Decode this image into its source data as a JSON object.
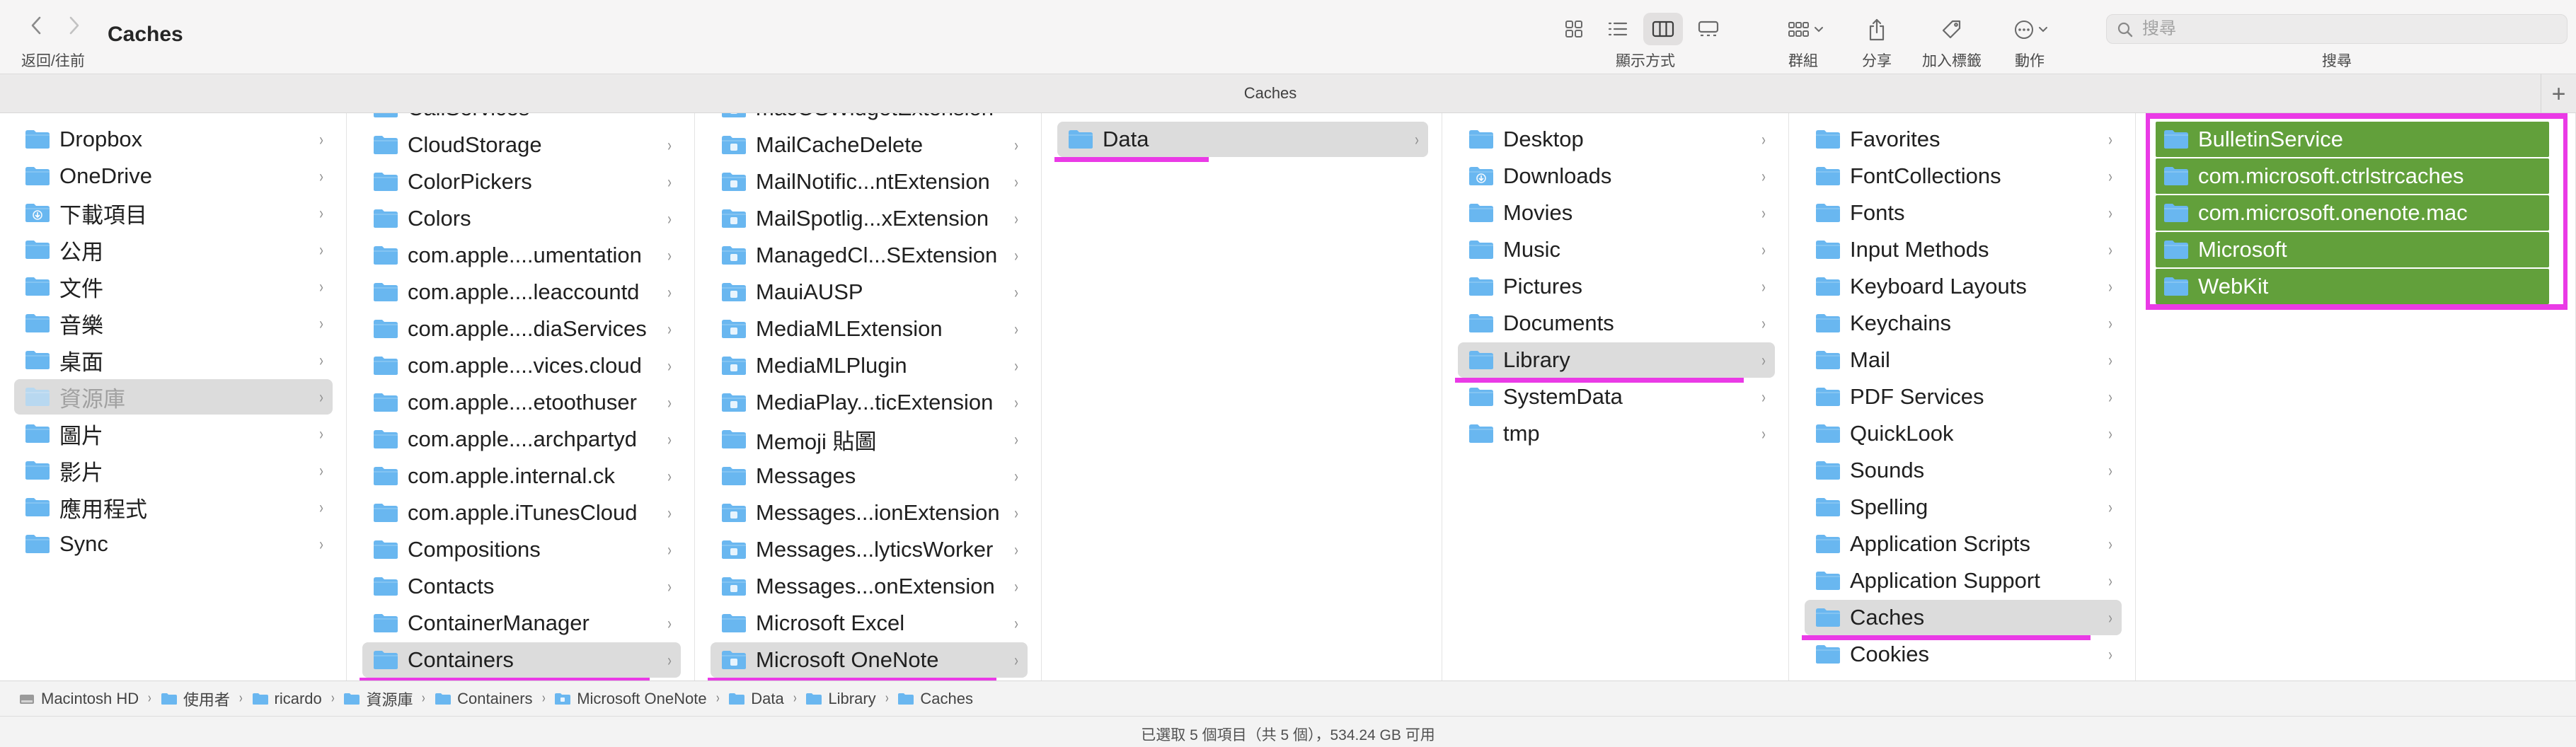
{
  "toolbar": {
    "title": "Caches",
    "nav_label": "返回/往前",
    "view_mode_label": "顯示方式",
    "group_label": "群組",
    "share_label": "分享",
    "tags_label": "加入標籤",
    "action_label": "動作",
    "search_label": "搜尋",
    "search_placeholder": "搜尋"
  },
  "tab": {
    "title": "Caches",
    "add_symbol": "+"
  },
  "colors": {
    "selection_mark": "#ea3ae6",
    "selected_green": "#62a03b",
    "folder_blue": "#6ab7f0"
  },
  "columns": [
    {
      "items": [
        {
          "label": "Dropbox",
          "icon": "folder-icon",
          "chevron": true
        },
        {
          "label": "OneDrive",
          "icon": "folder-icon",
          "chevron": true
        },
        {
          "label": "下載項目",
          "icon": "downloads-folder-icon",
          "chevron": true
        },
        {
          "label": "公用",
          "icon": "folder-icon",
          "chevron": true
        },
        {
          "label": "文件",
          "icon": "folder-icon",
          "chevron": true
        },
        {
          "label": "音樂",
          "icon": "folder-icon",
          "chevron": true
        },
        {
          "label": "桌面",
          "icon": "folder-icon",
          "chevron": true
        },
        {
          "label": "資源庫",
          "icon": "folder-icon",
          "chevron": true,
          "state": "selected-dim"
        },
        {
          "label": "圖片",
          "icon": "folder-icon",
          "chevron": true
        },
        {
          "label": "影片",
          "icon": "folder-icon",
          "chevron": true
        },
        {
          "label": "應用程式",
          "icon": "folder-icon",
          "chevron": true
        },
        {
          "label": "Sync",
          "icon": "folder-icon",
          "chevron": true
        }
      ]
    },
    {
      "items": [
        {
          "label": "CallServices",
          "icon": "folder-icon",
          "chevron": true
        },
        {
          "label": "CloudStorage",
          "icon": "folder-icon",
          "chevron": true
        },
        {
          "label": "ColorPickers",
          "icon": "folder-icon",
          "chevron": true
        },
        {
          "label": "Colors",
          "icon": "folder-icon",
          "chevron": true
        },
        {
          "label": "com.apple....umentation",
          "icon": "folder-icon",
          "chevron": true
        },
        {
          "label": "com.apple....leaccountd",
          "icon": "folder-icon",
          "chevron": true
        },
        {
          "label": "com.apple....diaServices",
          "icon": "folder-icon",
          "chevron": true
        },
        {
          "label": "com.apple....vices.cloud",
          "icon": "folder-icon",
          "chevron": true
        },
        {
          "label": "com.apple....etoothuser",
          "icon": "folder-icon",
          "chevron": true
        },
        {
          "label": "com.apple....archpartyd",
          "icon": "folder-icon",
          "chevron": true
        },
        {
          "label": "com.apple.internal.ck",
          "icon": "folder-icon",
          "chevron": true
        },
        {
          "label": "com.apple.iTunesCloud",
          "icon": "folder-icon",
          "chevron": true
        },
        {
          "label": "Compositions",
          "icon": "folder-icon",
          "chevron": true
        },
        {
          "label": "Contacts",
          "icon": "folder-icon",
          "chevron": true
        },
        {
          "label": "ContainerManager",
          "icon": "folder-icon",
          "chevron": true
        },
        {
          "label": "Containers",
          "icon": "folder-icon",
          "chevron": true,
          "state": "selected"
        }
      ]
    },
    {
      "items": [
        {
          "label": "macOSWidgetExtension",
          "icon": "app-folder-icon",
          "chevron": true
        },
        {
          "label": "MailCacheDelete",
          "icon": "app-folder-icon",
          "chevron": true
        },
        {
          "label": "MailNotific...ntExtension",
          "icon": "app-folder-icon",
          "chevron": true
        },
        {
          "label": "MailSpotlig...xExtension",
          "icon": "app-folder-icon",
          "chevron": true
        },
        {
          "label": "ManagedCl...SExtension",
          "icon": "app-folder-icon",
          "chevron": true
        },
        {
          "label": "MauiAUSP",
          "icon": "app-folder-icon",
          "chevron": true
        },
        {
          "label": "MediaMLExtension",
          "icon": "app-folder-icon",
          "chevron": true
        },
        {
          "label": "MediaMLPlugin",
          "icon": "app-folder-icon",
          "chevron": true
        },
        {
          "label": "MediaPlay...ticExtension",
          "icon": "app-folder-icon",
          "chevron": true
        },
        {
          "label": "Memoji 貼圖",
          "icon": "folder-icon",
          "chevron": true
        },
        {
          "label": "Messages",
          "icon": "folder-icon",
          "chevron": true
        },
        {
          "label": "Messages...ionExtension",
          "icon": "app-folder-icon",
          "chevron": true
        },
        {
          "label": "Messages...lyticsWorker",
          "icon": "app-folder-icon",
          "chevron": true
        },
        {
          "label": "Messages...onExtension",
          "icon": "app-folder-icon",
          "chevron": true
        },
        {
          "label": "Microsoft Excel",
          "icon": "folder-icon",
          "chevron": true
        },
        {
          "label": "Microsoft OneNote",
          "icon": "app-folder-icon",
          "chevron": true,
          "state": "selected"
        }
      ]
    },
    {
      "items": [
        {
          "label": "Data",
          "icon": "folder-icon",
          "chevron": true,
          "state": "selected"
        }
      ]
    },
    {
      "items": [
        {
          "label": "Desktop",
          "icon": "folder-icon",
          "chevron": true
        },
        {
          "label": "Downloads",
          "icon": "downloads-folder-icon",
          "chevron": true
        },
        {
          "label": "Movies",
          "icon": "folder-icon",
          "chevron": true
        },
        {
          "label": "Music",
          "icon": "folder-icon",
          "chevron": true
        },
        {
          "label": "Pictures",
          "icon": "folder-icon",
          "chevron": true
        },
        {
          "label": "Documents",
          "icon": "folder-icon",
          "chevron": true
        },
        {
          "label": "Library",
          "icon": "folder-icon",
          "chevron": true,
          "state": "selected"
        },
        {
          "label": "SystemData",
          "icon": "folder-icon",
          "chevron": true
        },
        {
          "label": "tmp",
          "icon": "folder-icon",
          "chevron": true
        }
      ]
    },
    {
      "items": [
        {
          "label": "Favorites",
          "icon": "folder-icon",
          "chevron": true
        },
        {
          "label": "FontCollections",
          "icon": "folder-icon",
          "chevron": true
        },
        {
          "label": "Fonts",
          "icon": "folder-icon",
          "chevron": true
        },
        {
          "label": "Input Methods",
          "icon": "folder-icon",
          "chevron": true
        },
        {
          "label": "Keyboard Layouts",
          "icon": "folder-icon",
          "chevron": true
        },
        {
          "label": "Keychains",
          "icon": "folder-icon",
          "chevron": true
        },
        {
          "label": "Mail",
          "icon": "folder-icon",
          "chevron": true
        },
        {
          "label": "PDF Services",
          "icon": "folder-icon",
          "chevron": true
        },
        {
          "label": "QuickLook",
          "icon": "folder-icon",
          "chevron": true
        },
        {
          "label": "Sounds",
          "icon": "folder-icon",
          "chevron": true
        },
        {
          "label": "Spelling",
          "icon": "folder-icon",
          "chevron": true
        },
        {
          "label": "Application Scripts",
          "icon": "folder-icon",
          "chevron": true
        },
        {
          "label": "Application Support",
          "icon": "folder-icon",
          "chevron": true
        },
        {
          "label": "Caches",
          "icon": "folder-icon",
          "chevron": true,
          "state": "selected"
        },
        {
          "label": "Cookies",
          "icon": "folder-icon",
          "chevron": true
        }
      ]
    },
    {
      "items": [
        {
          "label": "BulletinService",
          "icon": "folder-icon",
          "chevron": false,
          "state": "green"
        },
        {
          "label": "com.microsoft.ctrlstrcaches",
          "icon": "folder-icon",
          "chevron": false,
          "state": "green"
        },
        {
          "label": "com.microsoft.onenote.mac",
          "icon": "folder-icon",
          "chevron": false,
          "state": "green"
        },
        {
          "label": "Microsoft",
          "icon": "folder-icon",
          "chevron": false,
          "state": "green"
        },
        {
          "label": "WebKit",
          "icon": "folder-icon",
          "chevron": false,
          "state": "green"
        }
      ]
    }
  ],
  "path_bar": [
    {
      "label": "Macintosh HD",
      "icon": "drive-icon"
    },
    {
      "label": "使用者",
      "icon": "folder-icon"
    },
    {
      "label": "ricardo",
      "icon": "folder-icon"
    },
    {
      "label": "資源庫",
      "icon": "folder-icon"
    },
    {
      "label": "Containers",
      "icon": "folder-icon"
    },
    {
      "label": "Microsoft OneNote",
      "icon": "app-folder-icon"
    },
    {
      "label": "Data",
      "icon": "folder-icon"
    },
    {
      "label": "Library",
      "icon": "folder-icon"
    },
    {
      "label": "Caches",
      "icon": "folder-icon"
    }
  ],
  "status_bar": {
    "text": "已選取 5 個項目（共 5 個），534.24 GB 可用"
  }
}
